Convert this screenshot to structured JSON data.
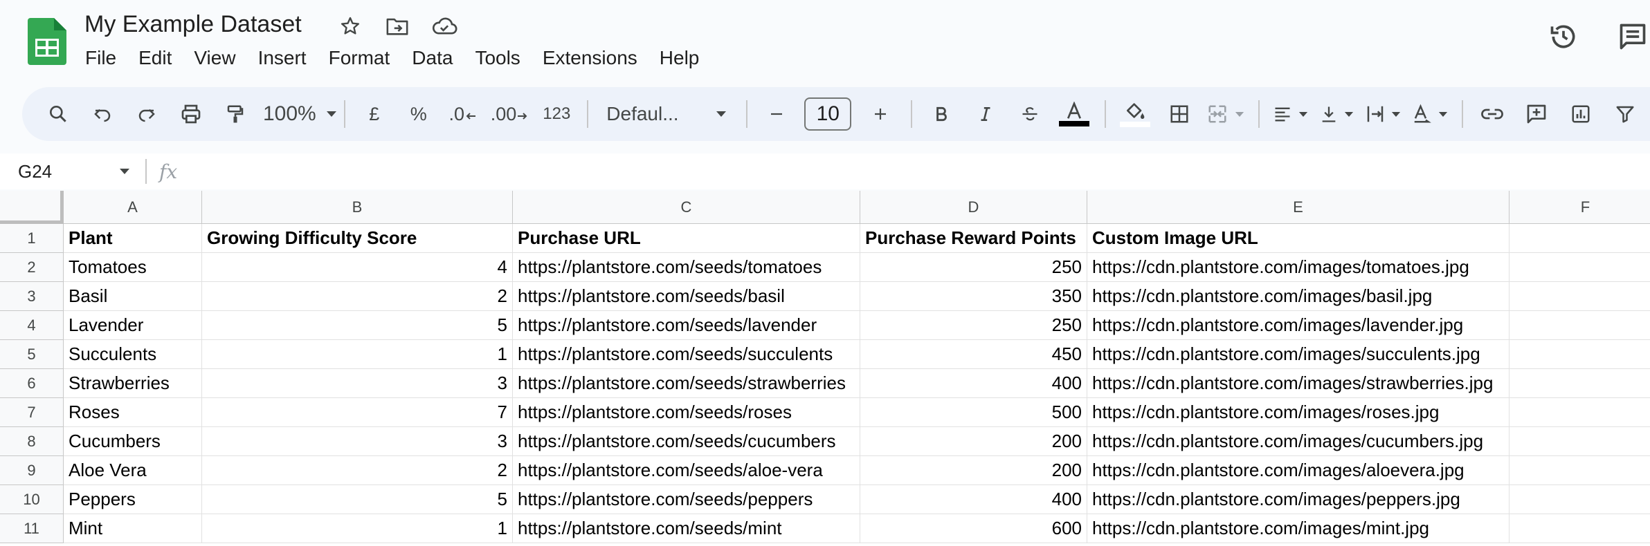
{
  "app": {
    "doc_title": "My Example Dataset",
    "menus": [
      "File",
      "Edit",
      "View",
      "Insert",
      "Format",
      "Data",
      "Tools",
      "Extensions",
      "Help"
    ],
    "brand_color": "#34a853"
  },
  "toolbar": {
    "zoom": "100%",
    "currency": "£",
    "percent": "%",
    "dec_decrease": ".0",
    "dec_increase": ".00",
    "more_formats": "123",
    "font_name": "Defaul...",
    "font_size": "10"
  },
  "formula_bar": {
    "cell_ref": "G24",
    "fx_label": "fx",
    "value": ""
  },
  "sheet": {
    "columns": [
      "A",
      "B",
      "C",
      "D",
      "E",
      "F"
    ],
    "row_numbers": [
      "1",
      "2",
      "3",
      "4",
      "5",
      "6",
      "7",
      "8",
      "9",
      "10",
      "11"
    ],
    "header_row": [
      "Plant",
      "Growing Difficulty Score",
      "Purchase URL",
      "Purchase Reward Points",
      "Custom Image URL",
      ""
    ],
    "rows": [
      [
        "Tomatoes",
        "4",
        "https://plantstore.com/seeds/tomatoes",
        "250",
        "https://cdn.plantstore.com/images/tomatoes.jpg",
        ""
      ],
      [
        "Basil",
        "2",
        "https://plantstore.com/seeds/basil",
        "350",
        "https://cdn.plantstore.com/images/basil.jpg",
        ""
      ],
      [
        "Lavender",
        "5",
        "https://plantstore.com/seeds/lavender",
        "250",
        "https://cdn.plantstore.com/images/lavender.jpg",
        ""
      ],
      [
        "Succulents",
        "1",
        "https://plantstore.com/seeds/succulents",
        "450",
        "https://cdn.plantstore.com/images/succulents.jpg",
        ""
      ],
      [
        "Strawberries",
        "3",
        "https://plantstore.com/seeds/strawberries",
        "400",
        "https://cdn.plantstore.com/images/strawberries.jpg",
        ""
      ],
      [
        "Roses",
        "7",
        "https://plantstore.com/seeds/roses",
        "500",
        "https://cdn.plantstore.com/images/roses.jpg",
        ""
      ],
      [
        "Cucumbers",
        "3",
        "https://plantstore.com/seeds/cucumbers",
        "200",
        "https://cdn.plantstore.com/images/cucumbers.jpg",
        ""
      ],
      [
        "Aloe Vera",
        "2",
        "https://plantstore.com/seeds/aloe-vera",
        "200",
        "https://cdn.plantstore.com/images/aloevera.jpg",
        ""
      ],
      [
        "Peppers",
        "5",
        "https://plantstore.com/seeds/peppers",
        "400",
        "https://cdn.plantstore.com/images/peppers.jpg",
        ""
      ],
      [
        "Mint",
        "1",
        "https://plantstore.com/seeds/mint",
        "600",
        "https://cdn.plantstore.com/images/mint.jpg",
        ""
      ]
    ]
  }
}
